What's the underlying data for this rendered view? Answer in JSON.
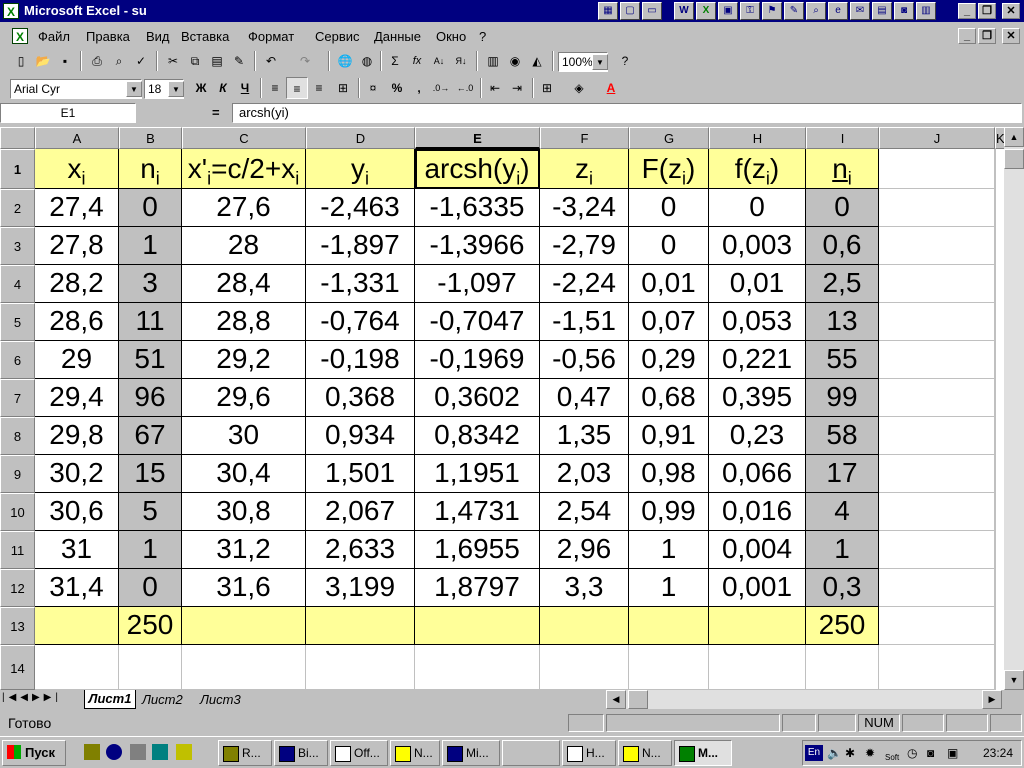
{
  "window": {
    "title": "Microsoft Excel - su"
  },
  "menu": [
    "Файл",
    "Правка",
    "Вид",
    "Вставка",
    "Формат",
    "Сервис",
    "Данные",
    "Окно",
    "?"
  ],
  "toolbar": {
    "zoom": "100%",
    "font": "Arial Cyr",
    "size": "18",
    "bold": "Ж",
    "italic": "К",
    "underline": "Ч",
    "percent": "%",
    "comma": ",",
    "sigma": "Σ",
    "fx": "fx"
  },
  "formula_bar": {
    "name_box": "E1",
    "equals": "=",
    "content": "arcsh(yi)"
  },
  "columns": [
    "A",
    "B",
    "C",
    "D",
    "E",
    "F",
    "G",
    "H",
    "I",
    "J",
    "K"
  ],
  "rows": [
    "1",
    "2",
    "3",
    "4",
    "5",
    "6",
    "7",
    "8",
    "9",
    "10",
    "11",
    "12",
    "13",
    "14"
  ],
  "header_row": [
    {
      "text": "x",
      "sub": "i"
    },
    {
      "text": "n",
      "sub": "i"
    },
    {
      "text": "x'",
      "sub": "i",
      "after": "=c/2+x",
      "sub2": "i"
    },
    {
      "text": "y",
      "sub": "i"
    },
    {
      "text": "arcsh(y",
      "sub": "i",
      "after": ")"
    },
    {
      "text": "z",
      "sub": "i"
    },
    {
      "text": "F(z",
      "sub": "i",
      "after": ")"
    },
    {
      "text": "f(z",
      "sub": "i",
      "after": ")"
    },
    {
      "text": "n",
      "sub": "i",
      "overline": true
    }
  ],
  "table": [
    [
      "27,4",
      "0",
      "27,6",
      "-2,463",
      "-1,6335",
      "-3,24",
      "0",
      "0",
      "0"
    ],
    [
      "27,8",
      "1",
      "28",
      "-1,897",
      "-1,3966",
      "-2,79",
      "0",
      "0,003",
      "0,6"
    ],
    [
      "28,2",
      "3",
      "28,4",
      "-1,331",
      "-1,097",
      "-2,24",
      "0,01",
      "0,01",
      "2,5"
    ],
    [
      "28,6",
      "11",
      "28,8",
      "-0,764",
      "-0,7047",
      "-1,51",
      "0,07",
      "0,053",
      "13"
    ],
    [
      "29",
      "51",
      "29,2",
      "-0,198",
      "-0,1969",
      "-0,56",
      "0,29",
      "0,221",
      "55"
    ],
    [
      "29,4",
      "96",
      "29,6",
      "0,368",
      "0,3602",
      "0,47",
      "0,68",
      "0,395",
      "99"
    ],
    [
      "29,8",
      "67",
      "30",
      "0,934",
      "0,8342",
      "1,35",
      "0,91",
      "0,23",
      "58"
    ],
    [
      "30,2",
      "15",
      "30,4",
      "1,501",
      "1,1951",
      "2,03",
      "0,98",
      "0,066",
      "17"
    ],
    [
      "30,6",
      "5",
      "30,8",
      "2,067",
      "1,4731",
      "2,54",
      "0,99",
      "0,016",
      "4"
    ],
    [
      "31",
      "1",
      "31,2",
      "2,633",
      "1,6955",
      "2,96",
      "1",
      "0,004",
      "1"
    ],
    [
      "31,4",
      "0",
      "31,6",
      "3,199",
      "1,8797",
      "3,3",
      "1",
      "0,001",
      "0,3"
    ]
  ],
  "totals_row": [
    "",
    "250",
    "",
    "",
    "",
    "",
    "",
    "",
    "250"
  ],
  "sheet_tabs": [
    "Лист1",
    "Лист2",
    "Лист3"
  ],
  "status": {
    "ready": "Готово",
    "num": "NUM"
  },
  "taskbar": {
    "start": "Пуск",
    "tasks": [
      "R...",
      "Bi...",
      "Off...",
      "N...",
      "Mi...",
      "",
      "H...",
      "N...",
      "M..."
    ],
    "lang": "En",
    "soft": "Soft",
    "clock": "23:24"
  },
  "colors": {
    "yellow": "#ffff99",
    "gray": "#c0c0c0",
    "title": "#000080"
  }
}
